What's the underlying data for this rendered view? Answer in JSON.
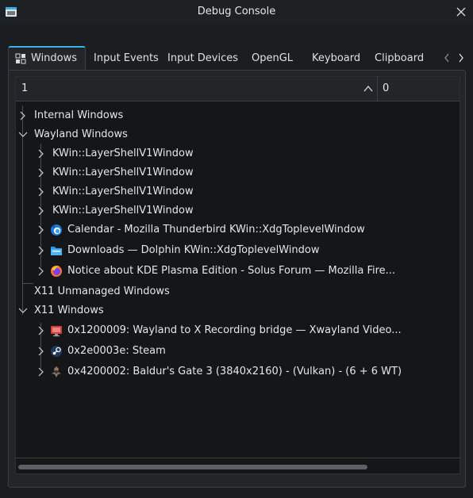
{
  "window": {
    "title": "Debug Console"
  },
  "tabs": [
    {
      "label": "Windows",
      "active": true
    },
    {
      "label": "Input Events"
    },
    {
      "label": "Input Devices"
    },
    {
      "label": "OpenGL"
    },
    {
      "label": "Keyboard"
    },
    {
      "label": "Clipboard"
    }
  ],
  "header": {
    "col1": "1",
    "col2": "0"
  },
  "tree": [
    {
      "label": "Internal Windows"
    },
    {
      "label": "Wayland Windows"
    },
    {
      "label": "KWin::LayerShellV1Window"
    },
    {
      "label": "KWin::LayerShellV1Window"
    },
    {
      "label": "KWin::LayerShellV1Window"
    },
    {
      "label": "KWin::LayerShellV1Window"
    },
    {
      "label": "Calendar - Mozilla Thunderbird KWin::XdgToplevelWindow",
      "icon": "thunderbird-icon"
    },
    {
      "label": "Downloads — Dolphin KWin::XdgToplevelWindow",
      "icon": "dolphin-folder-icon"
    },
    {
      "label": "Notice about KDE Plasma Edition - Solus Forum — Mozilla Fire...",
      "icon": "firefox-icon"
    },
    {
      "label": "X11 Unmanaged Windows"
    },
    {
      "label": "X11 Windows"
    },
    {
      "label": "0x1200009: Wayland to X Recording bridge — Xwayland Video...",
      "icon": "xwayland-bridge-icon"
    },
    {
      "label": "0x2e0003e: Steam",
      "icon": "steam-icon"
    },
    {
      "label": "0x4200002: Baldur's Gate 3 (3840x2160) - (Vulkan) - (6 + 6 WT)",
      "icon": "baldurs-gate-icon"
    }
  ],
  "colors": {
    "accent": "#3daee9",
    "background": "#1b1e20",
    "tree_bg": "#141618"
  }
}
